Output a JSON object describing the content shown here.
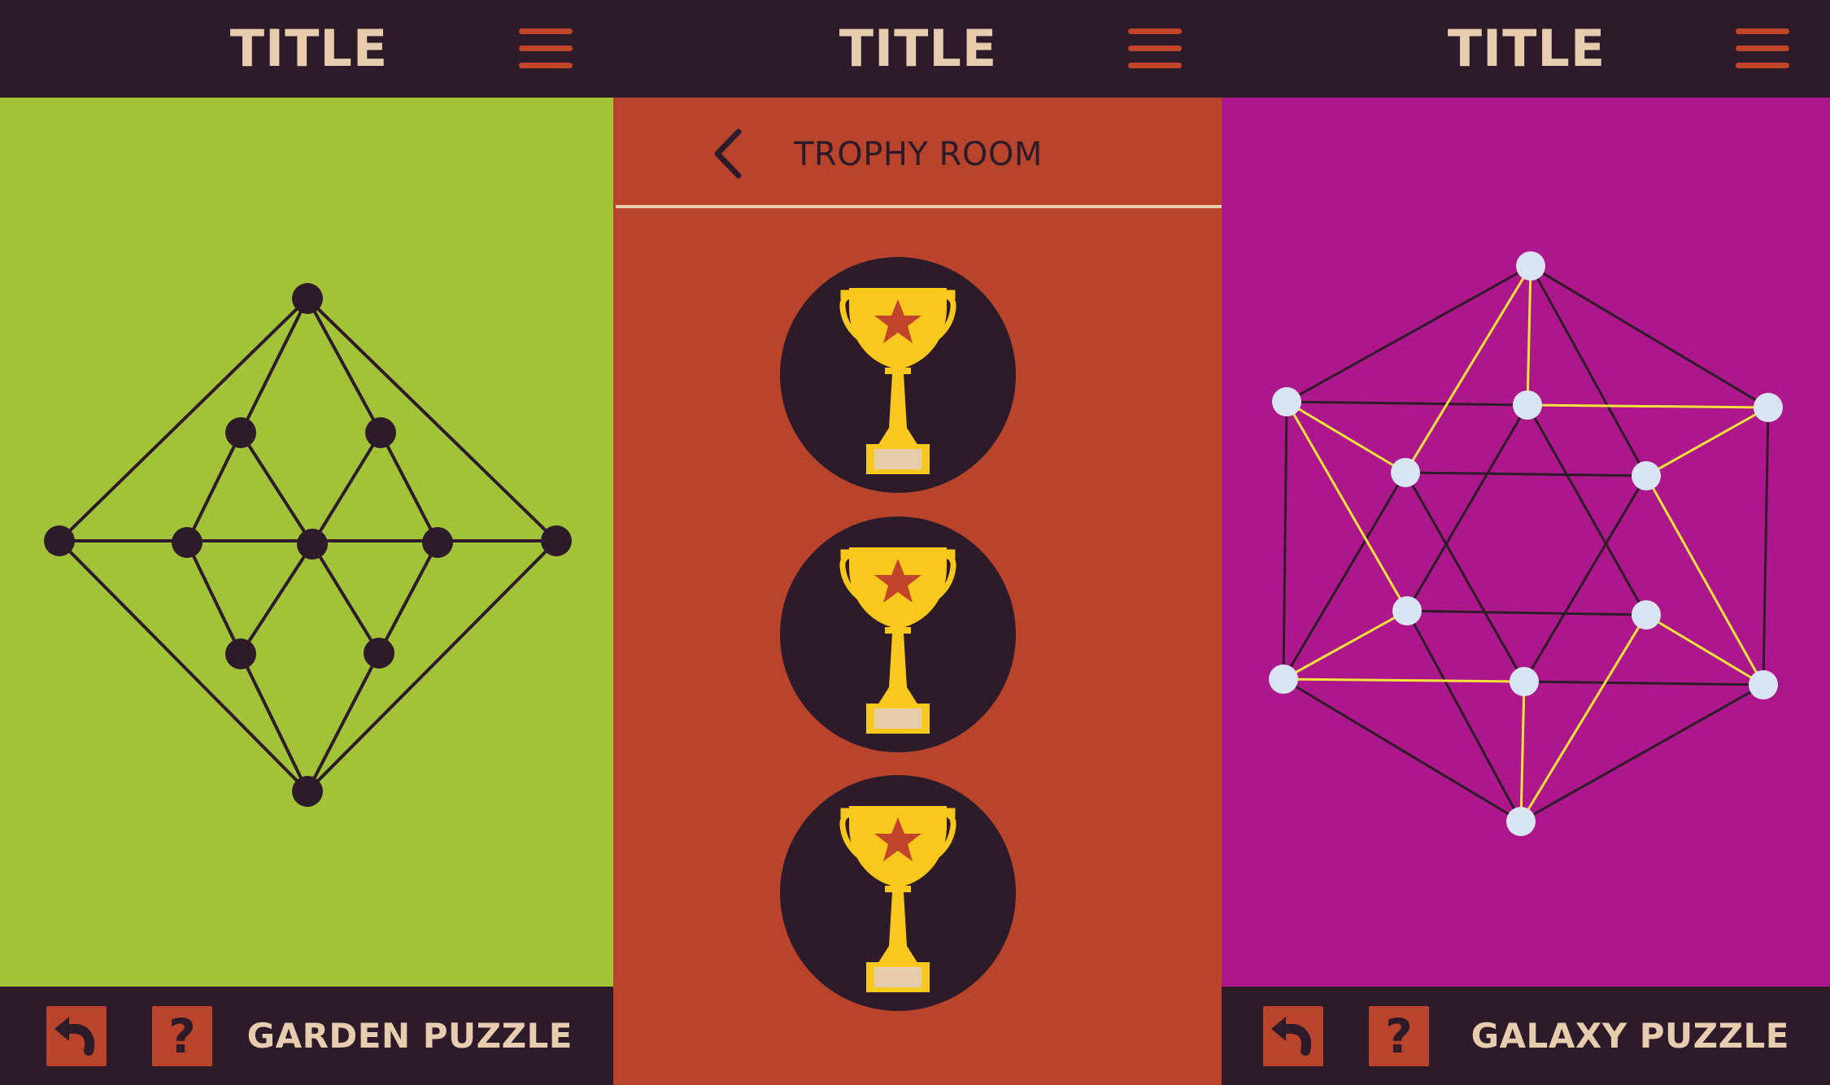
{
  "colors": {
    "dark": "#2e1b29",
    "cream": "#e7cdb0",
    "rust": "#b8442c",
    "menu_red": "#c0452b",
    "green": "#a2c23a",
    "magenta": "#ad178c",
    "gold": "#f9c81c",
    "node_light": "#d9e4f5",
    "edge_yellow": "#f4e33a"
  },
  "screens": [
    {
      "title": "TITLE",
      "menu_icon": "hamburger-menu-icon",
      "footer": {
        "undo_icon": "undo-arrow-icon",
        "help_label": "?",
        "puzzle_name": "GARDEN PUZZLE"
      }
    },
    {
      "title": "TITLE",
      "menu_icon": "hamburger-menu-icon",
      "back_icon": "chevron-left-icon",
      "section_title": "TROPHY ROOM",
      "trophies": [
        {
          "icon": "trophy-star-icon"
        },
        {
          "icon": "trophy-star-icon"
        },
        {
          "icon": "trophy-star-icon"
        }
      ]
    },
    {
      "title": "TITLE",
      "menu_icon": "hamburger-menu-icon",
      "footer": {
        "undo_icon": "undo-arrow-icon",
        "help_label": "?",
        "puzzle_name": "GALAXY PUZZLE"
      }
    }
  ]
}
